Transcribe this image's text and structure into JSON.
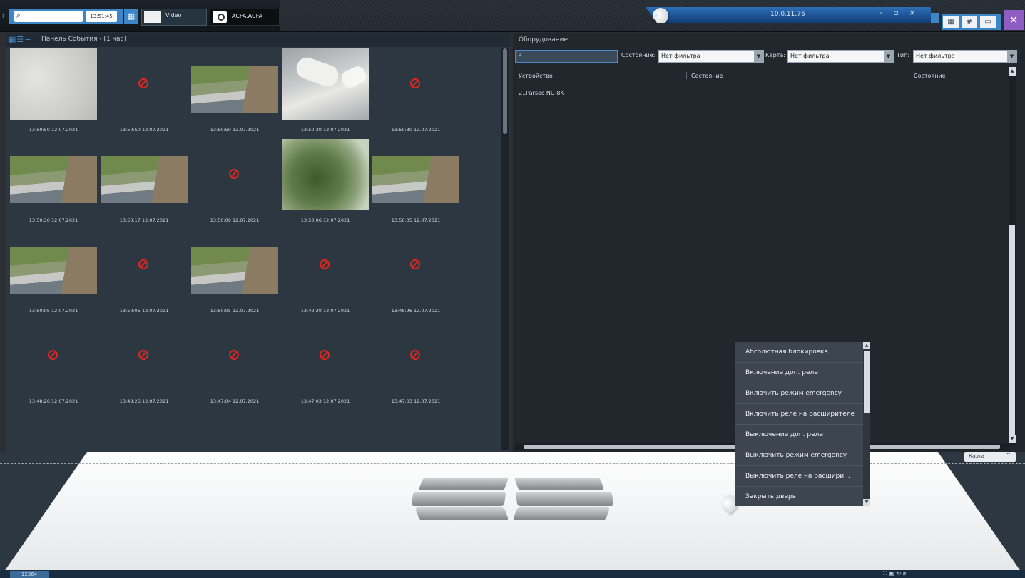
{
  "topbar": {
    "time": "13:51:45",
    "tabs": [
      {
        "label": "Video"
      },
      {
        "label": "ACFA.ACFA"
      }
    ],
    "connection_ip": "10.0.11.76",
    "window_controls": "- ▫ ×"
  },
  "events_panel": {
    "title": "Панель События - [1 час]",
    "events": [
      {
        "time": "13:50:50 12.07.2021",
        "kind": "snow"
      },
      {
        "time": "13:50:50 12.07.2021",
        "kind": "none"
      },
      {
        "time": "13:50:50 12.07.2021",
        "kind": "yard"
      },
      {
        "time": "13:50:30 12.07.2021",
        "kind": "cars"
      },
      {
        "time": "13:50:30 12.07.2021",
        "kind": "none"
      },
      {
        "time": "13:50:30 12.07.2021",
        "kind": "yard"
      },
      {
        "time": "13:50:17 12.07.2021",
        "kind": "yard"
      },
      {
        "time": "13:50:09 12.07.2021",
        "kind": "none"
      },
      {
        "time": "13:50:06 12.07.2021",
        "kind": "tree"
      },
      {
        "time": "13:50:05 12.07.2021",
        "kind": "yard"
      },
      {
        "time": "13:50:05 12.07.2021",
        "kind": "yard"
      },
      {
        "time": "13:50:05 12.07.2021",
        "kind": "none"
      },
      {
        "time": "13:50:05 12.07.2021",
        "kind": "yard"
      },
      {
        "time": "13:49:20 12.07.2021",
        "kind": "none"
      },
      {
        "time": "13:48:26 12.07.2021",
        "kind": "none"
      },
      {
        "time": "13:48:26 12.07.2021",
        "kind": "none"
      },
      {
        "time": "13:48:26 12.07.2021",
        "kind": "none"
      },
      {
        "time": "13:47:04 12.07.2021",
        "kind": "none"
      },
      {
        "time": "13:47:03 12.07.2021",
        "kind": "none"
      },
      {
        "time": "13:47:03 12.07.2021",
        "kind": "none"
      }
    ]
  },
  "equipment_panel": {
    "title": "Оборудование",
    "filters": {
      "state_label": "Состояние:",
      "state_value": "Нет фильтра",
      "map_label": "Карта:",
      "map_value": "Нет фильтра",
      "type_label": "Тип:",
      "type_value": "Нет фильтра"
    },
    "columns": [
      "Устройство",
      "Состояние",
      "Состояние"
    ],
    "rows": [
      {
        "device": "2..Parsec NC-8K"
      }
    ]
  },
  "map": {
    "button_label": "Карта"
  },
  "context_menu": {
    "items": [
      "Абсолютная блокировка",
      "Включение доп. реле",
      "Включить режим emergency",
      "Включить реле на расширителе",
      "Выключение доп. реле",
      "Выключить режим emergency",
      "Выключить реле на расшири...",
      "Закрыть дверь"
    ]
  },
  "statusbar": {
    "id": "12364"
  },
  "icons": [
    "search-icon",
    "grid-icon",
    "pin-icon",
    "tools-icon",
    "no-image-icon",
    "map-pin-icon"
  ]
}
